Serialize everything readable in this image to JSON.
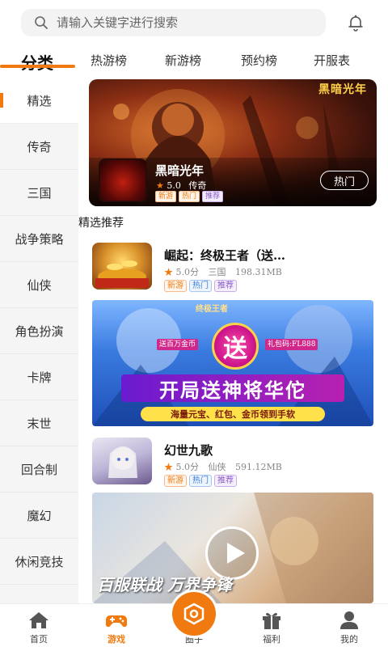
{
  "search": {
    "placeholder": "请输入关键字进行搜索"
  },
  "tabs": {
    "main": "分类",
    "items": [
      "热游榜",
      "新游榜",
      "预约榜",
      "开服表"
    ]
  },
  "sidebar": {
    "items": [
      {
        "label": "精选",
        "active": true
      },
      {
        "label": "传奇"
      },
      {
        "label": "三国"
      },
      {
        "label": "战争策略"
      },
      {
        "label": "仙侠"
      },
      {
        "label": "角色扮演"
      },
      {
        "label": "卡牌"
      },
      {
        "label": "末世"
      },
      {
        "label": "回合制"
      },
      {
        "label": "魔幻"
      },
      {
        "label": "休闲竞技"
      }
    ]
  },
  "banner": {
    "art_title": "黑暗光年",
    "game_name": "黑暗光年",
    "rating": "5.0",
    "category": "传奇",
    "tags": [
      "新游",
      "热门",
      "推荐"
    ],
    "hot_button": "热门"
  },
  "section": {
    "title": "精选推荐"
  },
  "games": [
    {
      "name": "崛起：终极王者（送…",
      "rating": "5.0分",
      "category": "三国",
      "size": "198.31MB",
      "tags": [
        "新游",
        "热门",
        "推荐"
      ]
    },
    {
      "name": "幻世九歌",
      "rating": "5.0分",
      "category": "仙侠",
      "size": "591.12MB",
      "tags": [
        "新游",
        "热门",
        "推荐"
      ]
    }
  ],
  "promo": {
    "header": "终极王者",
    "badge": "送",
    "left_note": "送百万金币",
    "right_note": "礼包码:FL888",
    "headline": "开局送神将华佗",
    "subline": "海量元宝、红包、金币领到手软"
  },
  "video": {
    "caption": "百服联战 万界争锋"
  },
  "bottom_nav": {
    "items": [
      {
        "label": "首页",
        "icon": "home-icon"
      },
      {
        "label": "游戏",
        "icon": "gamepad-icon",
        "active": true
      },
      {
        "label": "圈子",
        "icon": "hexagon-icon"
      },
      {
        "label": "福利",
        "icon": "gift-icon"
      },
      {
        "label": "我的",
        "icon": "user-icon"
      }
    ]
  },
  "colors": {
    "accent": "#f07a10",
    "rail_bg": "#f5f5f5"
  }
}
